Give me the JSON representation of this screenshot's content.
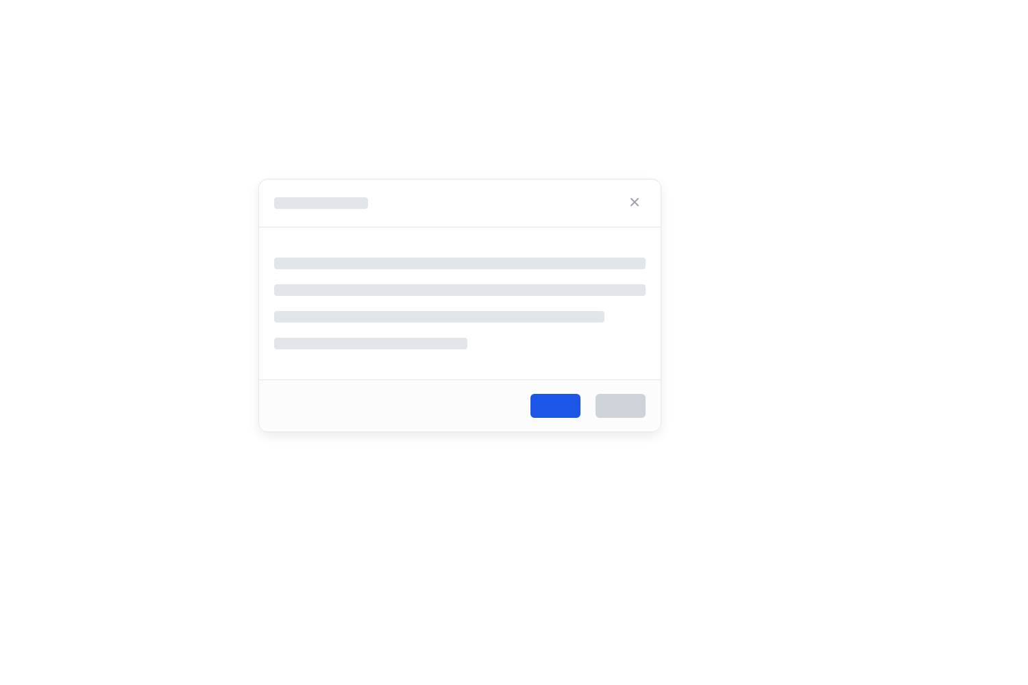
{
  "colors": {
    "primary": "#1c56e6",
    "skeleton": "#e2e6ea",
    "border": "#e5e7eb",
    "icon": "#9ca3af"
  },
  "modal": {
    "title": "",
    "body_lines": [
      {
        "width": "100%"
      },
      {
        "width": "100%"
      },
      {
        "width": "89%"
      },
      {
        "width": "52%"
      }
    ],
    "close_label": "Close",
    "footer": {
      "primary_label": "",
      "secondary_label": ""
    }
  }
}
